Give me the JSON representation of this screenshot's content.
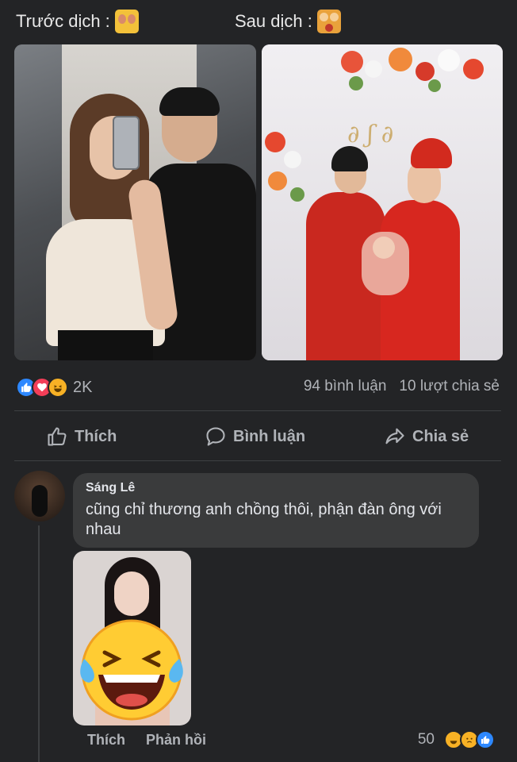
{
  "captions": {
    "before": "Trước dịch :",
    "after": "Sau dịch :"
  },
  "post": {
    "reaction_count": "2K",
    "comments": "94 bình luận",
    "shares": "10 lượt chia sẻ",
    "actions": {
      "like": "Thích",
      "comment": "Bình luận",
      "share": "Chia sẻ"
    }
  },
  "comment": {
    "author": "Sáng Lê",
    "text": "cũng chỉ thương anh chồng thôi, phận đàn ông với nhau",
    "like_label": "Thích",
    "reply_label": "Phản hồi",
    "reaction_count": "50"
  },
  "icons": {
    "reactions_post": [
      "like-icon",
      "love-icon",
      "haha-icon"
    ],
    "reactions_comment": [
      "haha-icon",
      "sad-icon",
      "like-icon"
    ]
  },
  "colors": {
    "background": "#232426",
    "like_blue": "#2d88ff",
    "love_red": "#f33e58",
    "haha_yellow": "#f7b125"
  }
}
